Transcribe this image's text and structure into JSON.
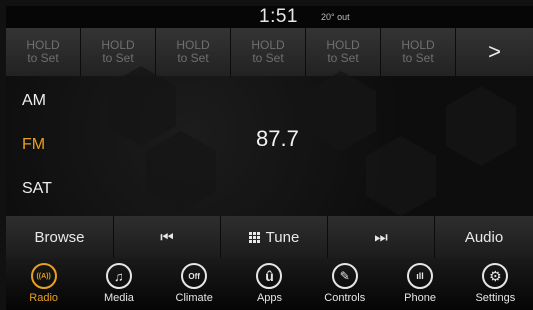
{
  "status": {
    "time": "1:51",
    "temperature": "20° out"
  },
  "presets": [
    {
      "l1": "HOLD",
      "l2": "to Set"
    },
    {
      "l1": "HOLD",
      "l2": "to Set"
    },
    {
      "l1": "HOLD",
      "l2": "to Set"
    },
    {
      "l1": "HOLD",
      "l2": "to Set"
    },
    {
      "l1": "HOLD",
      "l2": "to Set"
    },
    {
      "l1": "HOLD",
      "l2": "to Set"
    }
  ],
  "presets_next": ">",
  "bands": {
    "am": "AM",
    "fm": "FM",
    "sat": "SAT",
    "active": "FM"
  },
  "frequency": "87.7",
  "controls": {
    "browse": "Browse",
    "prev": "⏮",
    "tune": "Tune",
    "next": "⏭",
    "audio": "Audio"
  },
  "nav": [
    {
      "label": "Radio",
      "icon": "radio-icon",
      "glyph": "((A))",
      "active": true
    },
    {
      "label": "Media",
      "icon": "music-note-icon",
      "glyph": "♫"
    },
    {
      "label": "Climate",
      "icon": "climate-off-icon",
      "glyph": "Off"
    },
    {
      "label": "Apps",
      "icon": "apps-icon",
      "glyph": "û"
    },
    {
      "label": "Controls",
      "icon": "wrench-icon",
      "glyph": "✎"
    },
    {
      "label": "Phone",
      "icon": "phone-signal-icon",
      "glyph": "ıll"
    },
    {
      "label": "Settings",
      "icon": "gear-icon",
      "glyph": "⚙"
    }
  ],
  "colors": {
    "accent": "#e8a020",
    "text": "#eeeeee",
    "preset_text": "#6f6f6f"
  }
}
